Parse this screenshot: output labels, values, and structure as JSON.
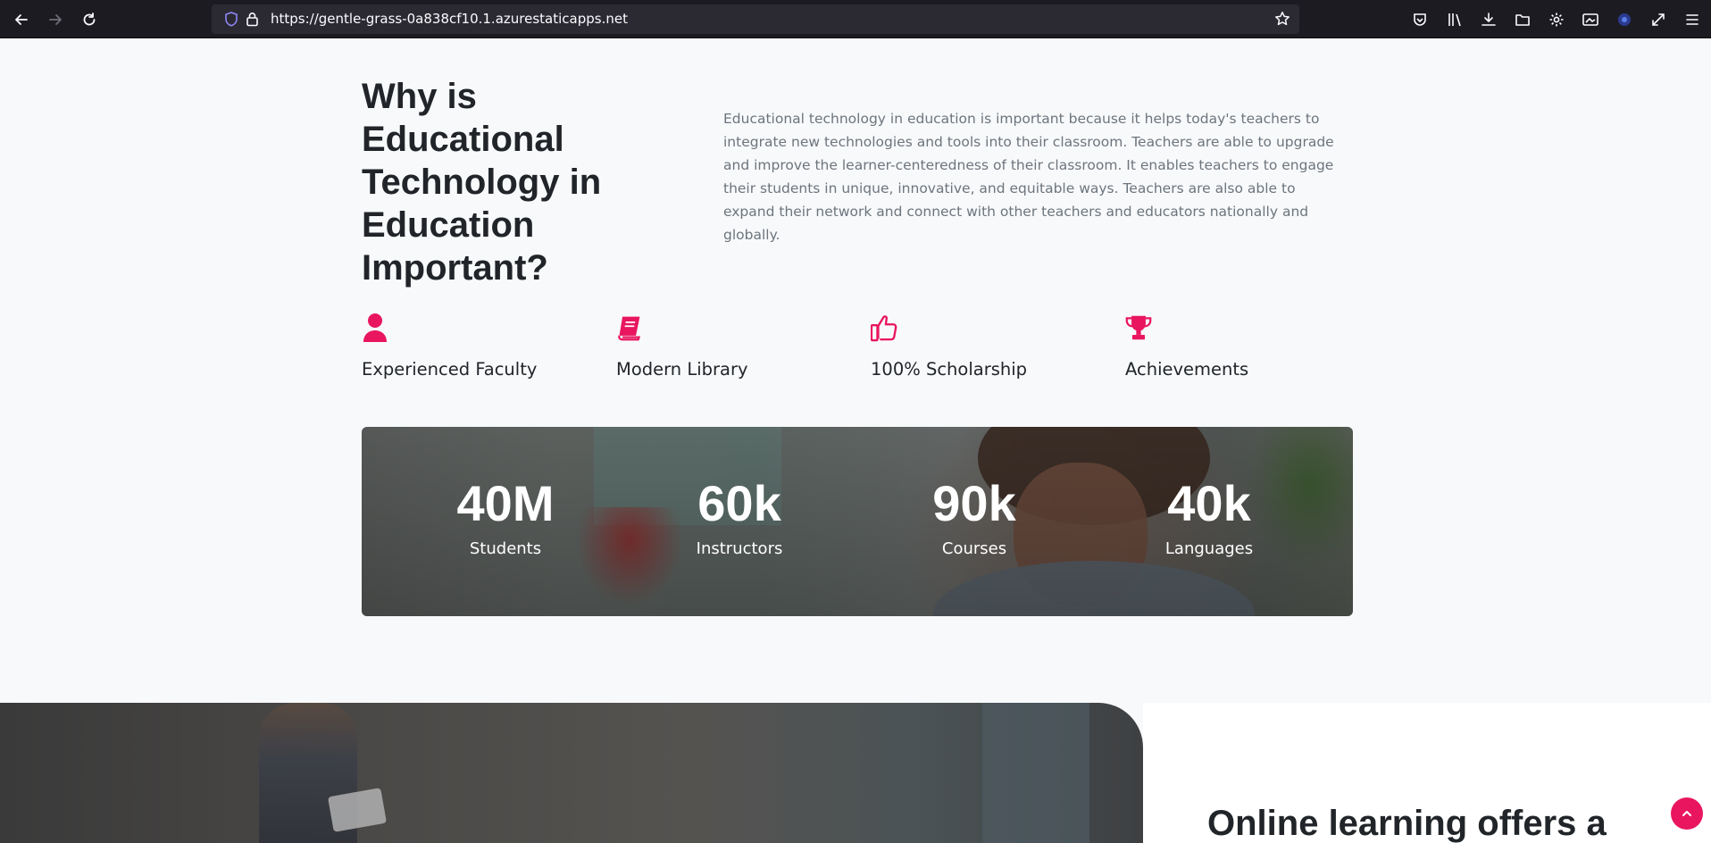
{
  "browser": {
    "url": "https://gentle-grass-0a838cf10.1.azurestaticapps.net"
  },
  "section": {
    "heading": "Why is Educational Technology in Education Important?",
    "paragraph": "Educational technology in education is important because it helps today's teachers to integrate new technologies and tools into their classroom. Teachers are able to upgrade and improve the learner-centeredness of their classroom. It enables teachers to engage their students in unique, innovative, and equitable ways. Teachers are also able to expand their network and connect with other teachers and educators nationally and globally."
  },
  "features": [
    {
      "icon": "user-icon",
      "title": "Experienced Faculty"
    },
    {
      "icon": "book-icon",
      "title": "Modern Library"
    },
    {
      "icon": "thumbs-up-icon",
      "title": "100% Scholarship"
    },
    {
      "icon": "trophy-icon",
      "title": "Achievements"
    }
  ],
  "stats": [
    {
      "value": "40M",
      "label": "Students"
    },
    {
      "value": "60k",
      "label": "Instructors"
    },
    {
      "value": "90k",
      "label": "Courses"
    },
    {
      "value": "40k",
      "label": "Languages"
    }
  ],
  "next_section": {
    "heading": "Online learning offers a"
  },
  "colors": {
    "accent": "#e9165f",
    "heading": "#212529",
    "body_text": "#6c757d"
  }
}
